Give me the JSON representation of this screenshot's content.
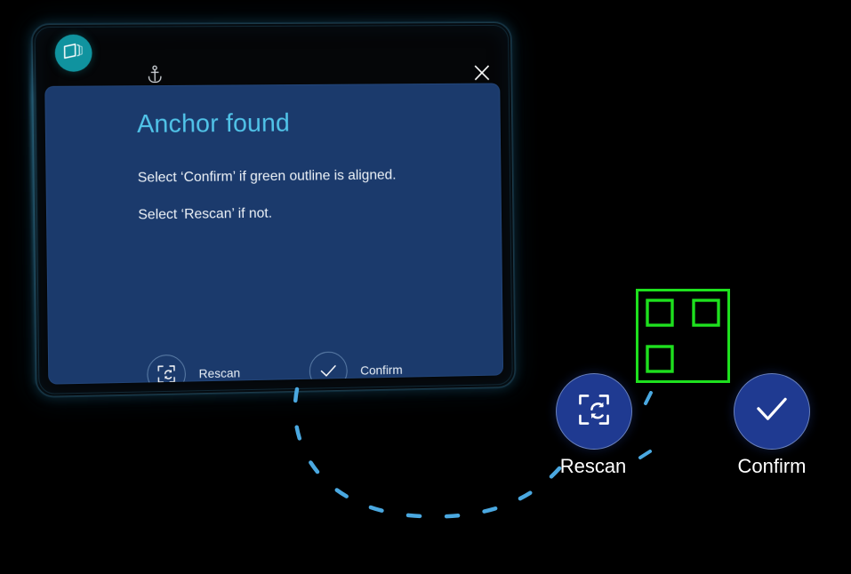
{
  "app": {
    "badge_icon": "hologram-panel-icon",
    "anchor_icon": "anchor-icon",
    "close_icon": "close-icon"
  },
  "dialog": {
    "title": "Anchor found",
    "line1": "Select ‘Confirm’ if green outline is aligned.",
    "line2": "Select ‘Rescan’ if not.",
    "buttons": [
      {
        "id": "rescan",
        "label": "Rescan",
        "icon": "rescan-frame-refresh-icon"
      },
      {
        "id": "confirm",
        "label": "Confirm",
        "icon": "checkmark-icon"
      }
    ]
  },
  "world_buttons": [
    {
      "id": "rescan",
      "label": "Rescan",
      "icon": "rescan-frame-refresh-icon"
    },
    {
      "id": "confirm",
      "label": "Confirm",
      "icon": "checkmark-icon"
    }
  ],
  "marker": {
    "name": "green-anchor-outline",
    "corner_squares": 3
  },
  "colors": {
    "background": "#000000",
    "panel_blue": "#1b3a6c",
    "title_cyan": "#51c4e9",
    "badge_teal": "#10939f",
    "button_blue": "#1f3a91",
    "marker_green": "#1ee01e",
    "connector_blue": "#4aa8e0",
    "text_primary": "#eef3f8"
  }
}
